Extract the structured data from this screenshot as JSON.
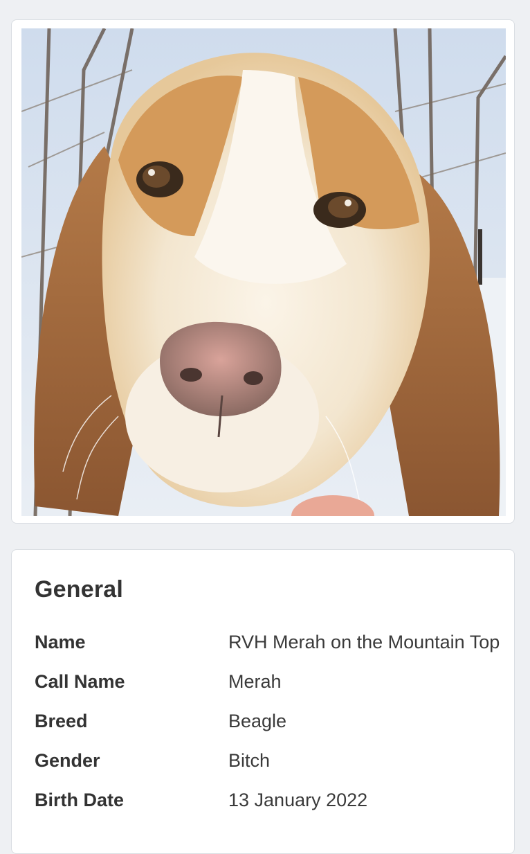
{
  "photo": {
    "subject": "beagle-portrait"
  },
  "general": {
    "title": "General",
    "rows": [
      {
        "label": "Name",
        "value": "RVH Merah on the Mountain Top"
      },
      {
        "label": "Call Name",
        "value": "Merah"
      },
      {
        "label": "Breed",
        "value": "Beagle"
      },
      {
        "label": "Gender",
        "value": "Bitch"
      },
      {
        "label": "Birth Date",
        "value": "13 January 2022"
      }
    ]
  },
  "colors": {
    "page_background": "#eef0f3",
    "card_background": "#ffffff",
    "card_border": "#d9dde2",
    "text": "#333333"
  }
}
